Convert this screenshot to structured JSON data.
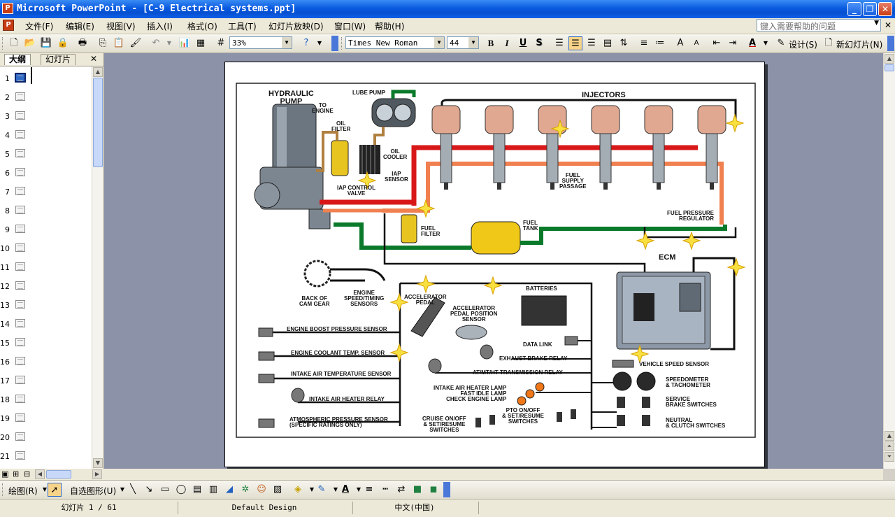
{
  "window": {
    "title": "Microsoft PowerPoint - [C-9 Electrical systems.ppt]",
    "controls": {
      "minimize": "_",
      "maximize": "❐",
      "close": "✕"
    }
  },
  "menu": {
    "items": [
      "文件(F)",
      "编辑(E)",
      "视图(V)",
      "插入(I)",
      "格式(O)",
      "工具(T)",
      "幻灯片放映(D)",
      "窗口(W)",
      "帮助(H)"
    ],
    "help_placeholder": "键入需要帮助的问题"
  },
  "toolbar": {
    "zoom": "33%",
    "font_name": "Times New Roman",
    "font_size": "44",
    "bold": "B",
    "italic": "I",
    "underline": "U",
    "shadow": "S",
    "design_label": "设计(S)",
    "new_slide_label": "新幻灯片(N)"
  },
  "left_panel": {
    "tabs": [
      "大纲",
      "幻灯片"
    ],
    "active_tab": 0,
    "slide_numbers": [
      "1",
      "2",
      "3",
      "4",
      "5",
      "6",
      "7",
      "8",
      "9",
      "10",
      "11",
      "12",
      "13",
      "14",
      "15",
      "16",
      "17",
      "18",
      "19",
      "20",
      "21"
    ],
    "selected_slide": 1
  },
  "diagram": {
    "labels": {
      "hydraulic_pump": "HYDRAULIC\nPUMP",
      "lube_pump": "LUBE PUMP",
      "to_engine": "TO\nENGINE",
      "oil_filter": "OIL\nFILTER",
      "oil_cooler": "OIL\nCOOLER",
      "iap_sensor": "IAP\nSENSOR",
      "iap_control_valve": "IAP CONTROL\nVALVE",
      "injectors": "INJECTORS",
      "fuel_supply_passage": "FUEL\nSUPPLY\nPASSAGE",
      "fuel_pressure_regulator": "FUEL PRESSURE\nREGULATOR",
      "fuel_filter": "FUEL\nFILTER",
      "fuel_tank": "FUEL\nTANK",
      "ecm": "ECM",
      "back_of_cam_gear": "BACK OF\nCAM GEAR",
      "engine_speed_timing": "ENGINE\nSPEED/TIMING\nSENSORS",
      "accelerator_pedal": "ACCELERATOR\nPEDAL",
      "accelerator_pedal_position": "ACCELERATOR\nPEDAL POSITION\nSENSOR",
      "batteries": "BATTERIES",
      "data_link": "DATA LINK",
      "exhaust_brake_relay": "EXHAUST BRAKE RELAY",
      "at_mt_ht_relay": "AT/MT/HT TRANSMISSION RELAY",
      "lamps": "INTAKE AIR HEATER LAMP\nFAST IDLE LAMP\nCHECK ENGINE LAMP",
      "vehicle_speed_sensor": "VEHICLE SPEED SENSOR",
      "speedometer": "SPEEDOMETER\n& TACHOMETER",
      "service_brake": "SERVICE\nBRAKE SWITCHES",
      "neutral_clutch": "NEUTRAL\n& CLUTCH SWITCHES",
      "pto": "PTO ON/OFF\n& SET/RESUME\nSWITCHES",
      "cruise": "CRUISE ON/OFF\n& SET/RESUME\nSWITCHES",
      "engine_boost": "ENGINE BOOST PRESSURE SENSOR",
      "engine_coolant": "ENGINE COOLANT TEMP. SENSOR",
      "intake_air_temp": "INTAKE AIR TEMPERATURE SENSOR",
      "intake_air_heater_relay": "INTAKE AIR HEATER RELAY",
      "atmospheric": "ATMOSPHERIC PRESSURE SENSOR\n(SPECIFIC RATINGS ONLY)"
    }
  },
  "drawbar": {
    "draw_label": "绘图(R)",
    "autoshapes_label": "自选图形(U)"
  },
  "status": {
    "slide_info": "幻灯片 1 / 61",
    "design": "Default Design",
    "language": "中文(中国)"
  }
}
